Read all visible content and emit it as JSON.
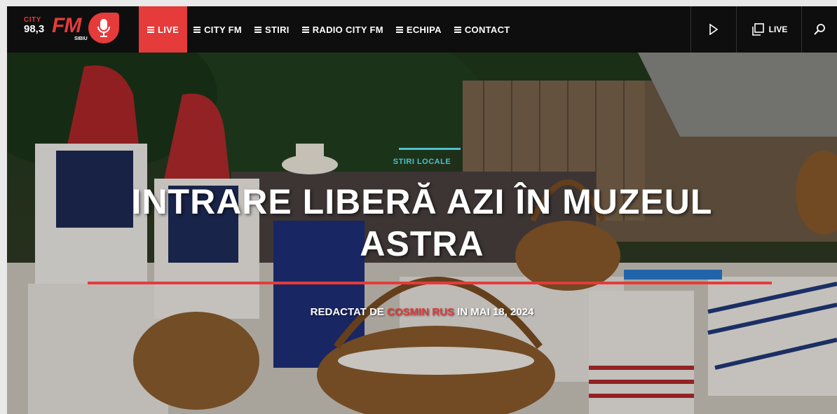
{
  "header": {
    "logo": {
      "city": "CITY",
      "frequency": "98,3",
      "fm": "FM",
      "city_sub": "SIBIU"
    },
    "nav": [
      {
        "label": "LIVE",
        "active": true
      },
      {
        "label": "CITY FM",
        "active": false
      },
      {
        "label": "STIRI",
        "active": false
      },
      {
        "label": "RADIO CITY FM",
        "active": false
      },
      {
        "label": "ECHIPA",
        "active": false
      },
      {
        "label": "CONTACT",
        "active": false
      }
    ],
    "tools": {
      "play_icon": "play-icon",
      "live_label": "LIVE",
      "live_icon": "copy-icon",
      "search_icon": "search-icon"
    }
  },
  "article": {
    "category": "STIRI LOCALE",
    "title": "INTRARE LIBERĂ AZI ÎN MUZEUL ASTRA",
    "byline_prefix": "REDACTAT DE",
    "author": "COSMIN RUS",
    "byline_date": "IN MAI 18, 2024"
  },
  "colors": {
    "accent": "#e53b3b",
    "category": "#4ec0cf",
    "header_bg": "#0e0e0e"
  }
}
